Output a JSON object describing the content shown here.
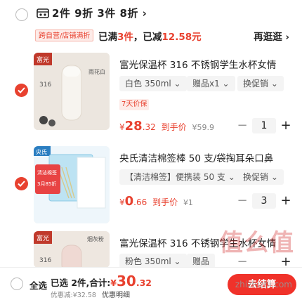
{
  "promo": {
    "icon": "coupon-icon",
    "text": "2件 9折 3件 8折 ›",
    "tag": "跨自营/店铺满折",
    "summary_prefix": "已满",
    "summary_count": "3件",
    "summary_mid": "，已减",
    "summary_amount": "12.58元",
    "more": "再逛逛 ›"
  },
  "items": [
    {
      "title": "富光保温杯 316 不锈钢学生水杯女情",
      "thumb_brand": "富光",
      "thumb_text1": "316",
      "thumb_text2": "雨花白",
      "spec_color": "白色 350ml ⌄",
      "spec_gift": "赠品x1 ⌄",
      "spec_swap": "换促销 ⌄",
      "tag": "7天价保",
      "price_sym": "¥",
      "price_int": "28",
      "price_dec": ".32",
      "price_label": "到手价",
      "price_orig": "¥59.9",
      "qty": "1",
      "minus": "−",
      "plus": "+"
    },
    {
      "title": "央氏清洁棉签棒 50 支/袋掏耳朵口鼻",
      "thumb_brand": "央氏",
      "thumb_text1": "清洁棉签",
      "thumb_text2": "3月85折",
      "spec_color": "【清洁棉签】便携装 50 支 ⌄",
      "spec_swap": "换促销 ⌄",
      "price_sym": "¥",
      "price_int": "0",
      "price_dec": ".66",
      "price_label": "到手价",
      "price_orig": "¥1",
      "qty": "3",
      "minus": "−",
      "plus": "+"
    },
    {
      "title": "富光保温杯 316 不锈钢学生水杯女情",
      "thumb_brand": "富光",
      "thumb_text1": "316",
      "thumb_text2": "烟灰粉",
      "spec_color": "粉色 350ml ⌄",
      "spec_gift": "赠品",
      "minus": "−",
      "plus": "+"
    }
  ],
  "footer": {
    "select_all": "全选",
    "selected": "已选 2件,合计:",
    "total_sym": "¥",
    "total_int": "30",
    "total_dec": ".32",
    "discount_label": "优惠减:",
    "discount_value": "¥32.58",
    "detail": "优惠明细",
    "checkout": "去结算"
  },
  "watermark": "值么值",
  "watermark_url": "zhizhizhi.com",
  "colors": {
    "accent": "#e8412f",
    "checkout": "#f0322a"
  }
}
